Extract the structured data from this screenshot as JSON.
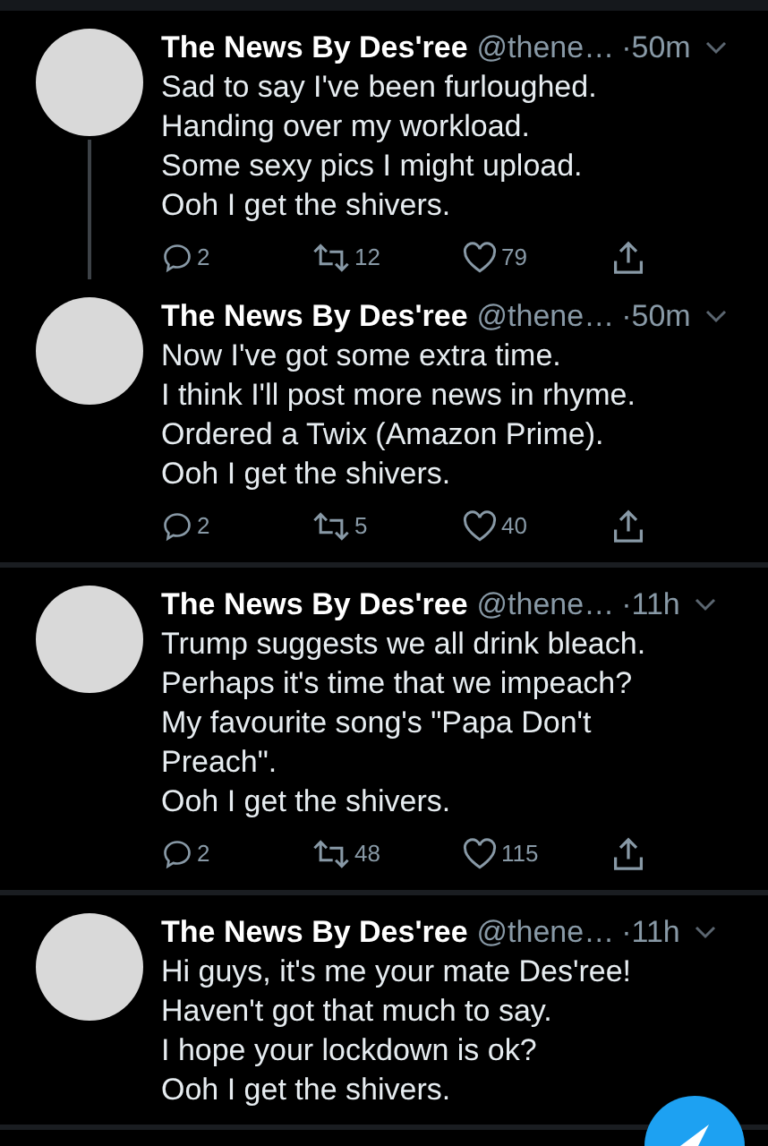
{
  "tweets": [
    {
      "name": "The News By Des'ree",
      "handle": "@thene…",
      "time": "·50m",
      "thread_line": true,
      "lines": [
        "Sad to say I've been furloughed.",
        "Handing over my workload.",
        "Some sexy pics I might upload.",
        "Ooh I get the shivers."
      ],
      "replies": "2",
      "retweets": "12",
      "likes": "79"
    },
    {
      "name": "The News By Des'ree",
      "handle": "@thene…",
      "time": "·50m",
      "thread_line": false,
      "lines": [
        "Now I've got some extra time.",
        "I think I'll post more news in rhyme.",
        "Ordered a Twix (Amazon Prime).",
        "Ooh I get the shivers."
      ],
      "replies": "2",
      "retweets": "5",
      "likes": "40"
    },
    {
      "name": "The News By Des'ree",
      "handle": "@thene…",
      "time": "·11h",
      "thread_line": false,
      "lines": [
        "Trump suggests we all drink bleach.",
        "Perhaps it's time that we impeach?",
        "My favourite song's \"Papa Don't Preach\".",
        "Ooh I get the shivers."
      ],
      "replies": "2",
      "retweets": "48",
      "likes": "115"
    },
    {
      "name": "The News By Des'ree",
      "handle": "@thene…",
      "time": "·11h",
      "thread_line": false,
      "lines": [
        "Hi guys, it's me your mate Des'ree!",
        "Haven't got that much to say.",
        "I hope your lockdown is ok?",
        "Ooh I get the shivers."
      ]
    }
  ]
}
